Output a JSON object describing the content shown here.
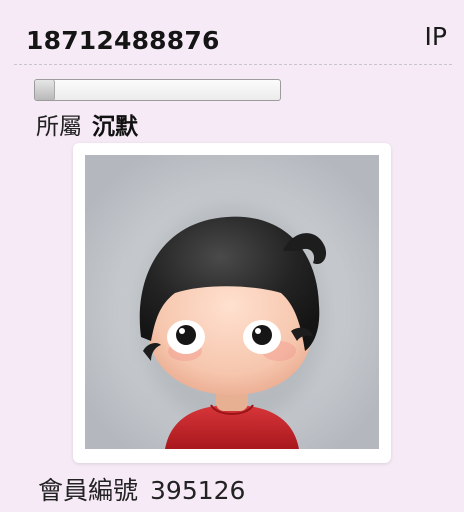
{
  "profile": {
    "username": "18712488876",
    "ip_label": "IP",
    "progress": 0.08,
    "affiliation_label": "所屬",
    "affiliation_value": "沉默",
    "member_label": "會員編號",
    "member_number": "395126"
  },
  "colors": {
    "background": "#f6eaf6",
    "frame": "#ffffff",
    "hair": "#1f1f1f",
    "skin": "#f6c8ad",
    "shirt": "#c8262b",
    "avatar_bg": "#c2c6cb"
  },
  "icons": {
    "avatar": "cartoon-boy-avatar"
  }
}
